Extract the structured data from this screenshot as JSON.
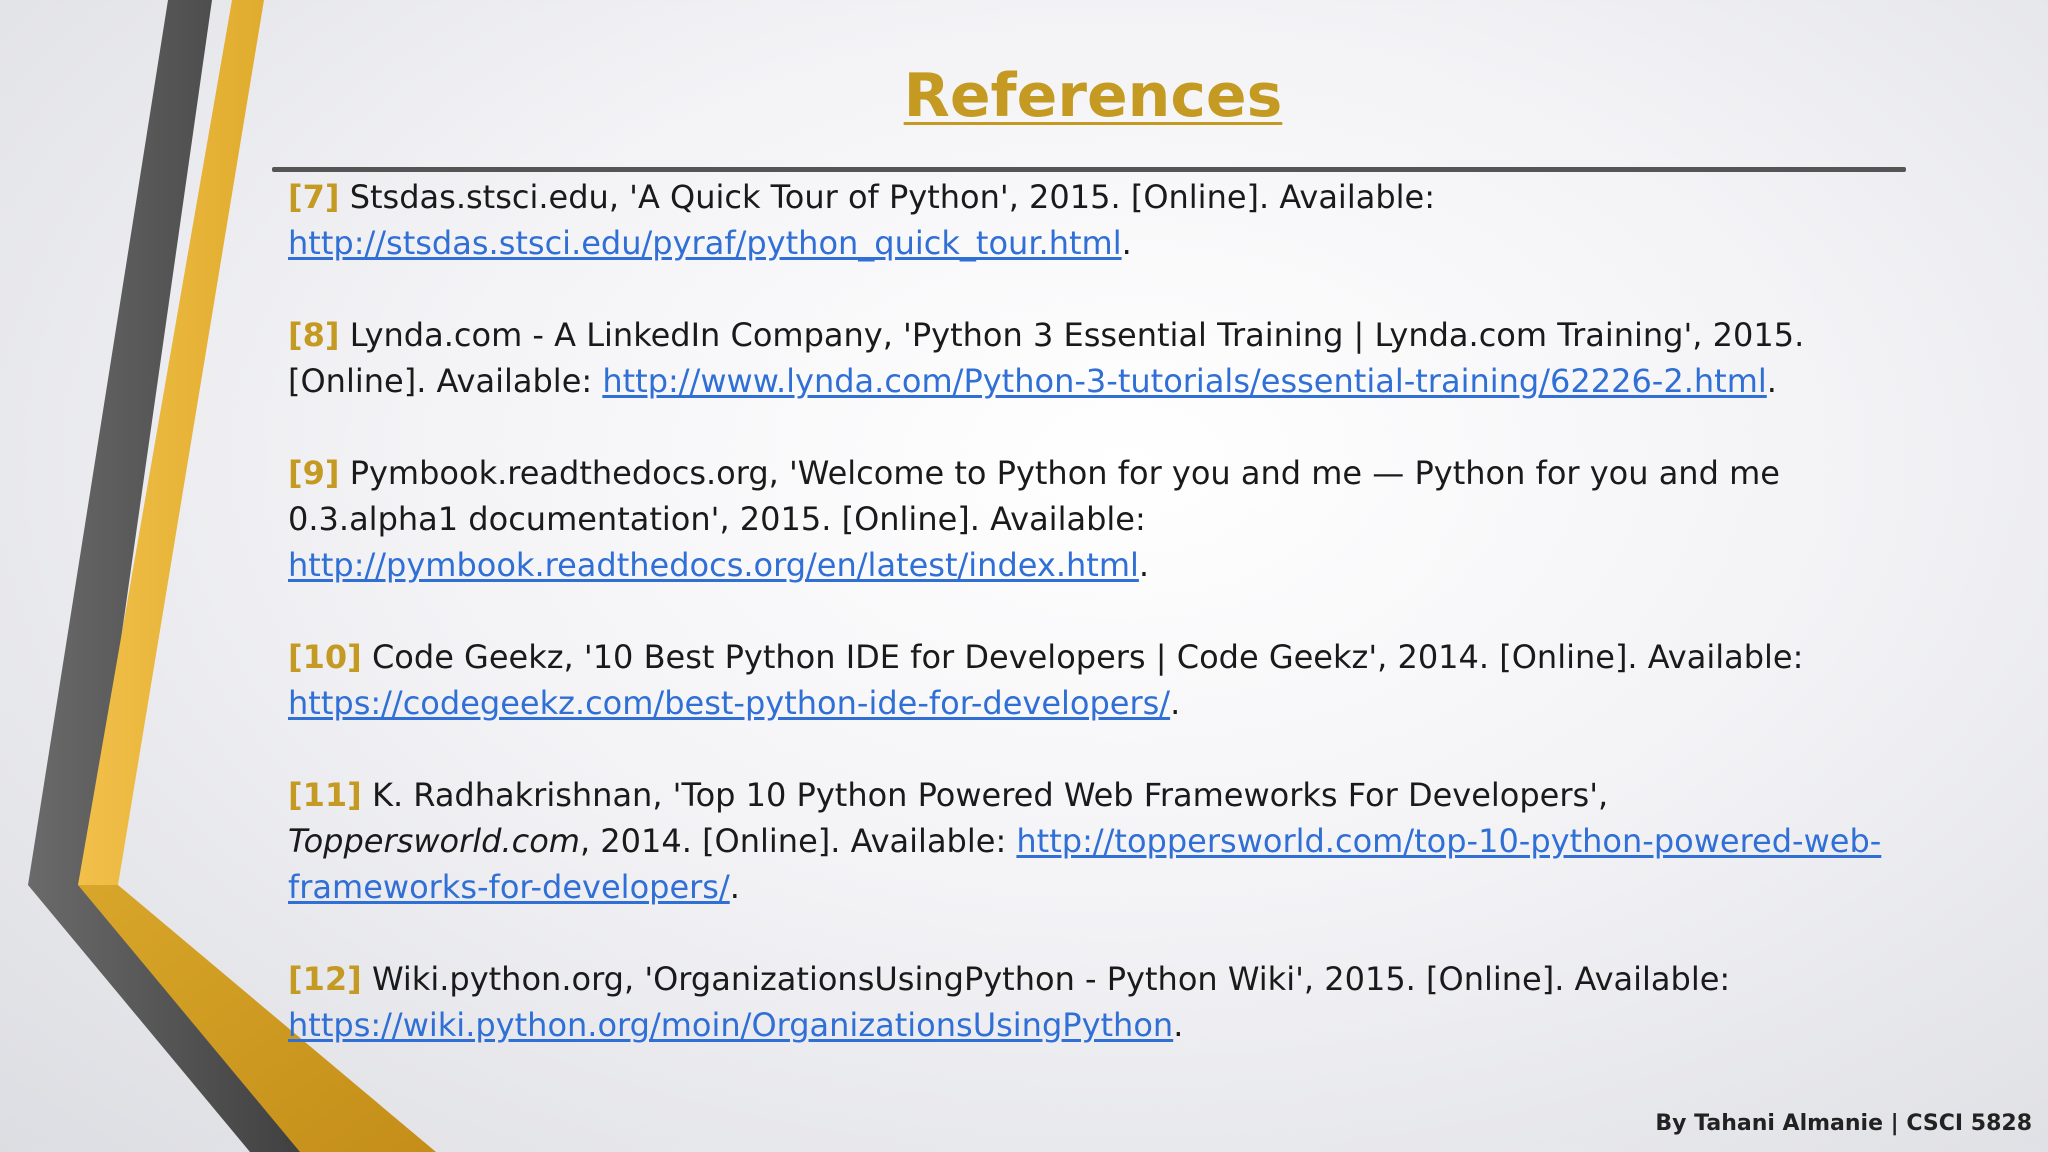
{
  "slide": {
    "title": "References",
    "footer": "By Tahani Almanie | CSCI 5828"
  },
  "references": [
    {
      "num": "[7]",
      "text": " Stsdas.stsci.edu, 'A Quick Tour of Python', 2015. [Online]. Available: ",
      "url": "http://stsdas.stsci.edu/pyraf/python_quick_tour.html",
      "tail": "."
    },
    {
      "num": "[8]",
      "text": " Lynda.com - A LinkedIn Company, 'Python 3 Essential Training | Lynda.com Training', 2015. [Online]. Available: ",
      "url": "http://www.lynda.com/Python-3-tutorials/essential-training/62226-2.html",
      "tail": "."
    },
    {
      "num": "[9]",
      "text": " Pymbook.readthedocs.org, 'Welcome to Python for you and me — Python for you and me 0.3.alpha1 documentation', 2015. [Online]. Available: ",
      "url": "http://pymbook.readthedocs.org/en/latest/index.html",
      "tail": "."
    },
    {
      "num": "[10]",
      "text": " Code Geekz, '10 Best Python IDE for Developers | Code Geekz', 2014. [Online]. Available: ",
      "url": "https://codegeekz.com/best-python-ide-for-developers/",
      "tail": "."
    },
    {
      "num": "[11]",
      "text": " K.  Radhakrishnan, 'Top 10 Python Powered Web Frameworks For Developers', ",
      "italic": "Toppersworld.com",
      "text2": ", 2014. [Online]. Available: ",
      "url": "http://toppersworld.com/top-10-python-powered-web-frameworks-for-developers/",
      "tail": "."
    },
    {
      "num": "[12]",
      "text": " Wiki.python.org, 'OrganizationsUsingPython - Python Wiki', 2015. [Online]. Available: ",
      "url": "https://wiki.python.org/moin/OrganizationsUsingPython",
      "tail": "."
    }
  ]
}
